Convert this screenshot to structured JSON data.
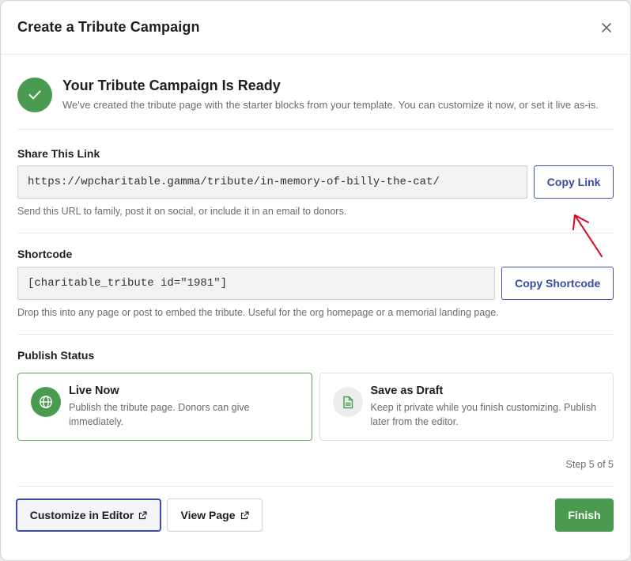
{
  "modal": {
    "title": "Create a Tribute Campaign"
  },
  "ready": {
    "title": "Your Tribute Campaign Is Ready",
    "description": "We've created the tribute page with the starter blocks from your template. You can customize it now, or set it live as-is."
  },
  "share": {
    "label": "Share This Link",
    "url": "https://wpcharitable.gamma/tribute/in-memory-of-billy-the-cat/",
    "button": "Copy Link",
    "help": "Send this URL to family, post it on social, or include it in an email to donors."
  },
  "shortcode": {
    "label": "Shortcode",
    "value": "[charitable_tribute id=\"1981\"]",
    "button": "Copy Shortcode",
    "help": "Drop this into any page or post to embed the tribute. Useful for the org homepage or a memorial landing page."
  },
  "publish": {
    "label": "Publish Status",
    "options": [
      {
        "title": "Live Now",
        "description": "Publish the tribute page. Donors can give immediately.",
        "icon": "globe-icon",
        "selected": true
      },
      {
        "title": "Save as Draft",
        "description": "Keep it private while you finish customizing. Publish later from the editor.",
        "icon": "document-icon",
        "selected": false
      }
    ]
  },
  "step": "Step 5 of 5",
  "footer": {
    "customize": "Customize in Editor",
    "view": "View Page",
    "finish": "Finish"
  },
  "colors": {
    "accent_green": "#4a9b4f",
    "accent_blue": "#3a4b9f",
    "annotation_red": "#e0001b"
  }
}
